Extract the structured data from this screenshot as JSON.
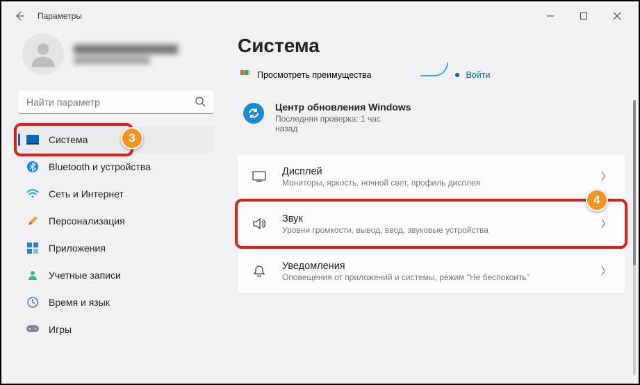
{
  "window": {
    "title": "Параметры"
  },
  "search": {
    "placeholder": "Найти параметр"
  },
  "sidebar": {
    "items": [
      {
        "label": "Система"
      },
      {
        "label": "Bluetooth и устройства"
      },
      {
        "label": "Сеть и Интернет"
      },
      {
        "label": "Персонализация"
      },
      {
        "label": "Приложения"
      },
      {
        "label": "Учетные записи"
      },
      {
        "label": "Время и язык"
      },
      {
        "label": "Игры"
      }
    ]
  },
  "main": {
    "heading": "Система",
    "banner": {
      "benefits": "Просмотреть преимущества",
      "signin": "Войти"
    },
    "update": {
      "title": "Центр обновления Windows",
      "sub": "Последняя проверка: 1 час назад"
    },
    "cards": {
      "display": {
        "title": "Дисплей",
        "sub": "Мониторы, яркость, ночной свет, профиль дисплея"
      },
      "sound": {
        "title": "Звук",
        "sub": "Уровни громкости, вывод, ввод, звуковые устройства"
      },
      "notif": {
        "title": "Уведомления",
        "sub": "Оповещения от приложений и системы, режим \"Не беспокоить\""
      }
    }
  },
  "badges": {
    "b3": "3",
    "b4": "4"
  }
}
